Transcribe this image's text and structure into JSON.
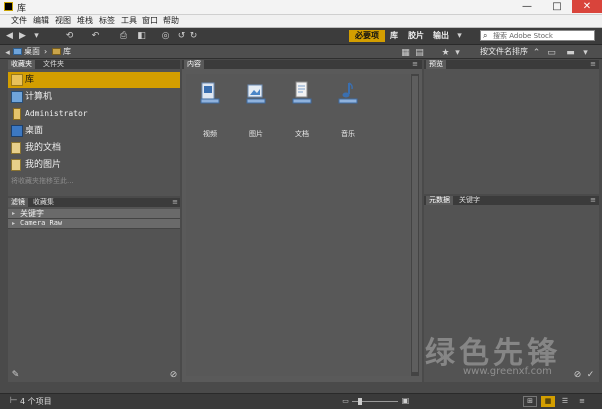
{
  "window": {
    "title": "库",
    "controls": {
      "minimize": "—",
      "maximize": "□",
      "close": "✕"
    }
  },
  "menu": [
    "文件",
    "编辑",
    "视图",
    "堆栈",
    "标签",
    "工具",
    "窗口",
    "帮助"
  ],
  "toolbar": {
    "workspaces": [
      "必要项",
      "库",
      "胶片",
      "输出"
    ],
    "active_workspace": "必要项",
    "search_placeholder": "搜索 Adobe Stock"
  },
  "path": {
    "items": [
      "桌面",
      "库"
    ],
    "sort_label": "按文件名排序"
  },
  "favorites_panel": {
    "tabs": [
      "收藏夹",
      "文件夹"
    ],
    "items": [
      {
        "label": "库",
        "icon": "library-icon",
        "selected": true
      },
      {
        "label": "计算机",
        "icon": "computer-icon"
      },
      {
        "label": "Administrator",
        "icon": "user-folder-icon"
      },
      {
        "label": "桌面",
        "icon": "desktop-icon"
      },
      {
        "label": "我的文档",
        "icon": "documents-icon"
      },
      {
        "label": "我的图片",
        "icon": "pictures-icon"
      }
    ],
    "hint": "将收藏夹拖移至此..."
  },
  "filter_panel": {
    "tabs": [
      "滤镜",
      "收藏集"
    ],
    "rows": [
      "关键字",
      "Camera Raw"
    ]
  },
  "content_panel": {
    "tab": "内容",
    "items": [
      {
        "label": "视频",
        "icon": "video-library-icon"
      },
      {
        "label": "图片",
        "icon": "pictures-library-icon"
      },
      {
        "label": "文档",
        "icon": "documents-library-icon"
      },
      {
        "label": "音乐",
        "icon": "music-library-icon"
      }
    ]
  },
  "preview_panel": {
    "tab": "预览"
  },
  "metadata_panel": {
    "tabs": [
      "元数据",
      "关键字"
    ]
  },
  "status": {
    "count": "4 个项目"
  },
  "watermark": {
    "text": "绿色先锋",
    "url": "www.greenxf.com"
  },
  "colors": {
    "accent": "#d39e00",
    "panel": "#535353",
    "dark": "#3a3a3a"
  }
}
